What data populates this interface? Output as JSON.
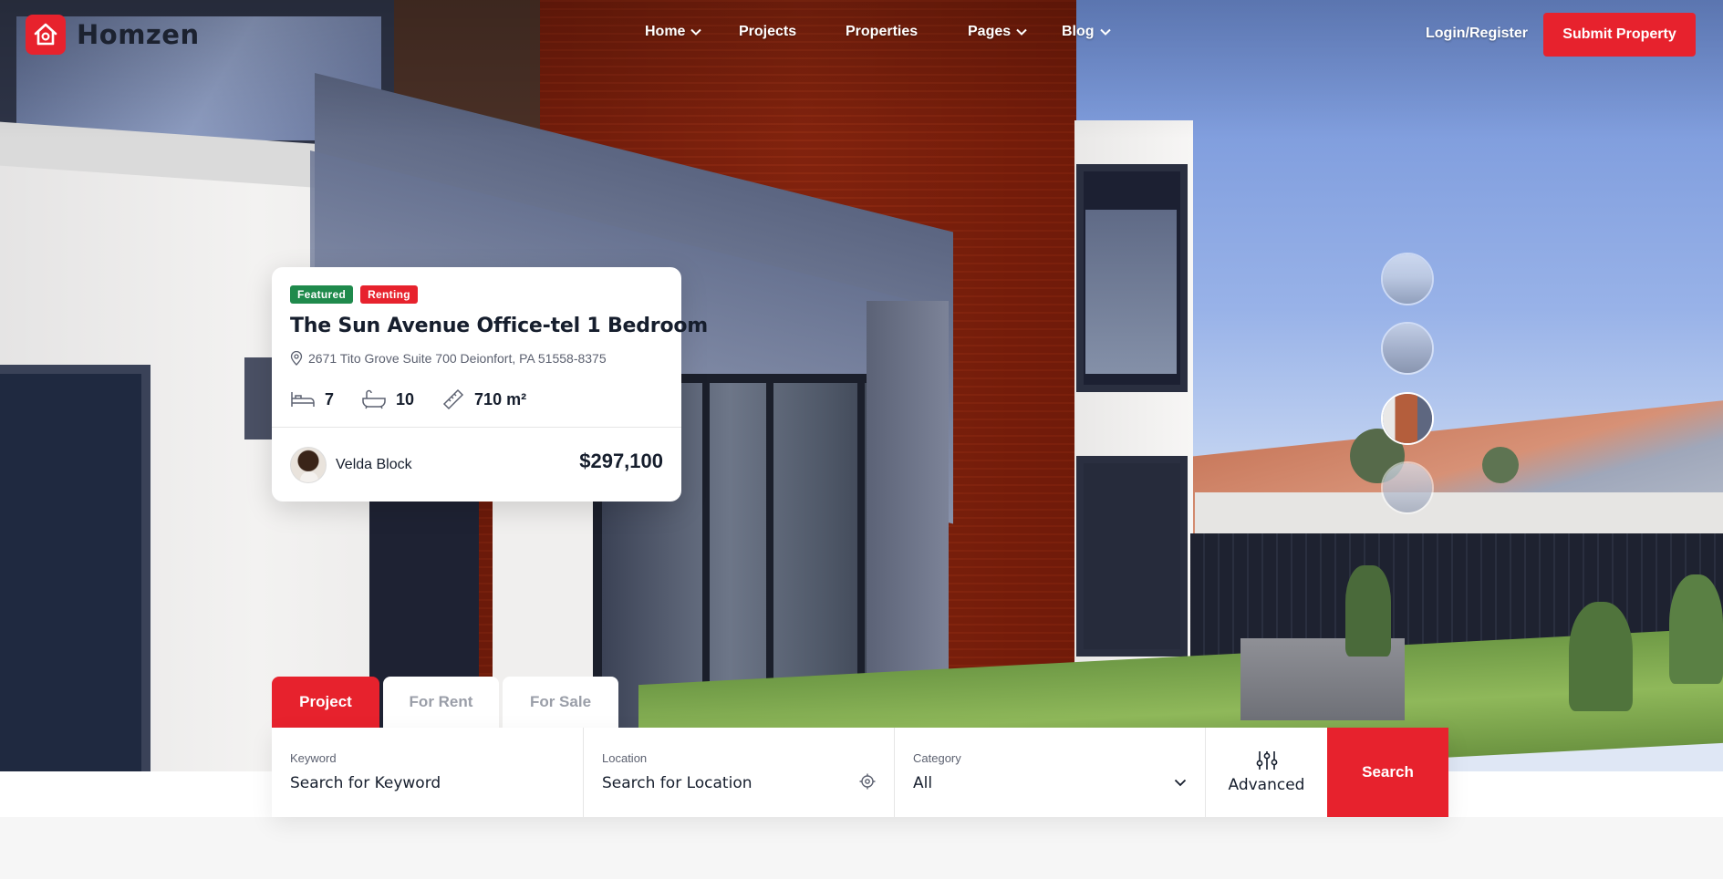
{
  "brand": {
    "name": "Homzen",
    "accent": "#e7222d"
  },
  "nav": {
    "items": [
      {
        "label": "Home",
        "has_dropdown": true
      },
      {
        "label": "Projects",
        "has_dropdown": false
      },
      {
        "label": "Properties",
        "has_dropdown": false
      },
      {
        "label": "Pages",
        "has_dropdown": true
      },
      {
        "label": "Blog",
        "has_dropdown": true
      }
    ],
    "login_label": "Login/Register",
    "submit_label": "Submit Property"
  },
  "property_card": {
    "badges": {
      "featured": "Featured",
      "renting": "Renting"
    },
    "title": "The Sun Avenue Office-tel 1 Bedroom",
    "address": "2671 Tito Grove Suite 700 Deionfort, PA 51558-8375",
    "beds": "7",
    "baths": "10",
    "area": "710 m²",
    "agent_name": "Velda Block",
    "price": "$297,100"
  },
  "thumbnails": {
    "count": 4,
    "active_index": 2
  },
  "search": {
    "tabs": [
      {
        "label": "Project",
        "active": true
      },
      {
        "label": "For Rent",
        "active": false
      },
      {
        "label": "For Sale",
        "active": false
      }
    ],
    "keyword": {
      "label": "Keyword",
      "value": "Search for Keyword"
    },
    "location": {
      "label": "Location",
      "value": "Search for Location"
    },
    "category": {
      "label": "Category",
      "value": "All"
    },
    "advanced_label": "Advanced",
    "search_label": "Search"
  }
}
